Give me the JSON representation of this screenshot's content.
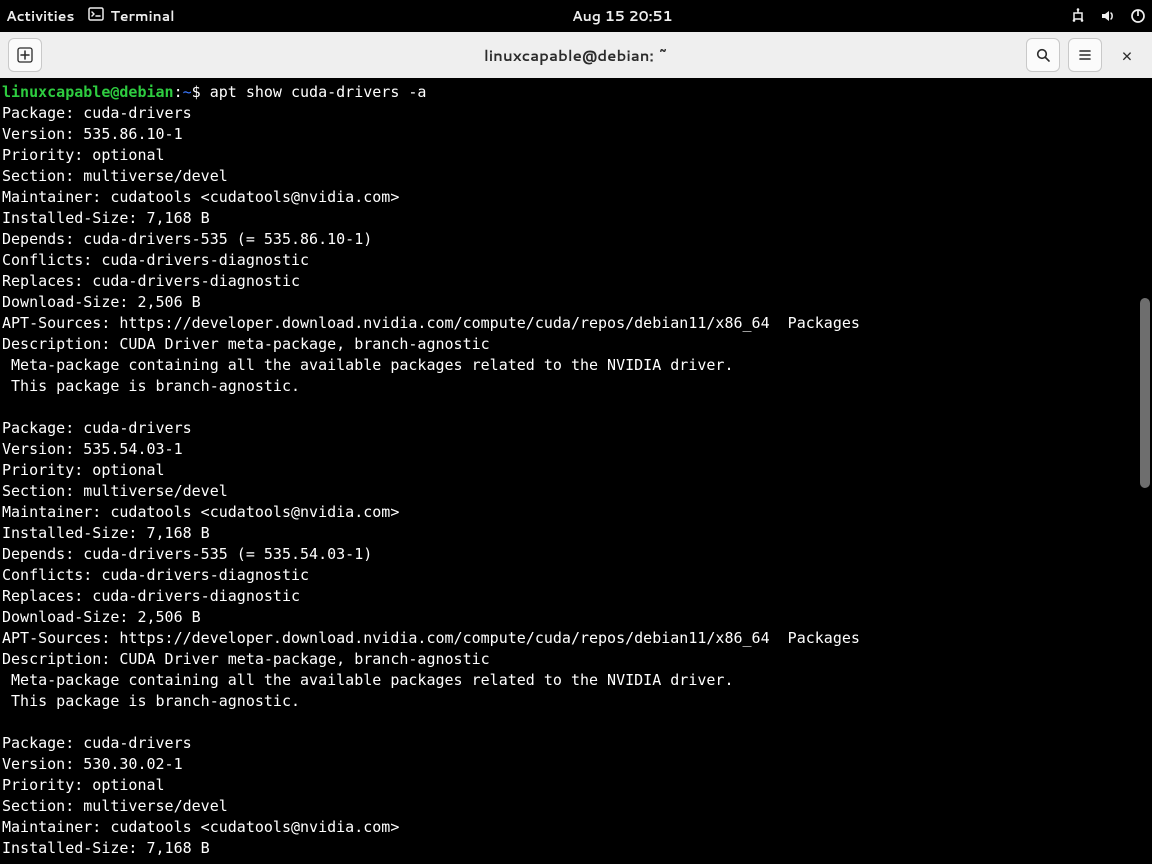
{
  "topPanel": {
    "activities": "Activities",
    "appName": "Terminal",
    "clock": "Aug 15  20:51"
  },
  "headerbar": {
    "title": "linuxcapable@debian: ~"
  },
  "terminal": {
    "prompt": {
      "user_host": "linuxcapable@debian",
      "colon": ":",
      "path": "~",
      "dollar": "$ "
    },
    "command": "apt show cuda-drivers -a",
    "packages": [
      {
        "Package": "cuda-drivers",
        "Version": "535.86.10-1",
        "Priority": "optional",
        "Section": "multiverse/devel",
        "Maintainer": "cudatools <cudatools@nvidia.com>",
        "Installed-Size": "7,168 B",
        "Depends": "cuda-drivers-535 (= 535.86.10-1)",
        "Conflicts": "cuda-drivers-diagnostic",
        "Replaces": "cuda-drivers-diagnostic",
        "Download-Size": "2,506 B",
        "APT-Sources": "https://developer.download.nvidia.com/compute/cuda/repos/debian11/x86_64  Packages",
        "Description": "CUDA Driver meta-package, branch-agnostic",
        "DescLong": " Meta-package containing all the available packages related to the NVIDIA driver.\n This package is branch-agnostic."
      },
      {
        "Package": "cuda-drivers",
        "Version": "535.54.03-1",
        "Priority": "optional",
        "Section": "multiverse/devel",
        "Maintainer": "cudatools <cudatools@nvidia.com>",
        "Installed-Size": "7,168 B",
        "Depends": "cuda-drivers-535 (= 535.54.03-1)",
        "Conflicts": "cuda-drivers-diagnostic",
        "Replaces": "cuda-drivers-diagnostic",
        "Download-Size": "2,506 B",
        "APT-Sources": "https://developer.download.nvidia.com/compute/cuda/repos/debian11/x86_64  Packages",
        "Description": "CUDA Driver meta-package, branch-agnostic",
        "DescLong": " Meta-package containing all the available packages related to the NVIDIA driver.\n This package is branch-agnostic."
      },
      {
        "Package": "cuda-drivers",
        "Version": "530.30.02-1",
        "Priority": "optional",
        "Section": "multiverse/devel",
        "Maintainer": "cudatools <cudatools@nvidia.com>",
        "Installed-Size": "7,168 B"
      }
    ]
  }
}
